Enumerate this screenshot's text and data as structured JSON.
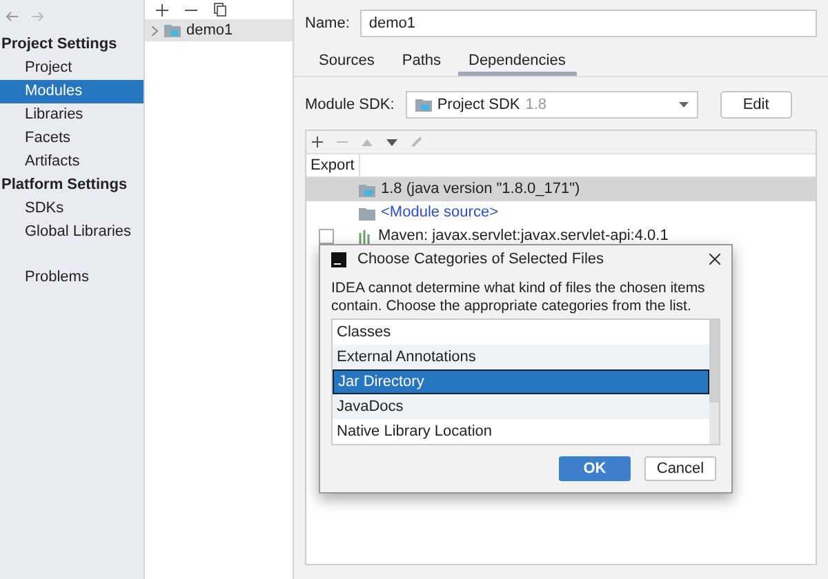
{
  "sidebar": {
    "items": [
      {
        "kind": "header",
        "label": "Project Settings",
        "selected": false
      },
      {
        "kind": "item",
        "label": "Project",
        "selected": false
      },
      {
        "kind": "item",
        "label": "Modules",
        "selected": true
      },
      {
        "kind": "item",
        "label": "Libraries",
        "selected": false
      },
      {
        "kind": "item",
        "label": "Facets",
        "selected": false
      },
      {
        "kind": "item",
        "label": "Artifacts",
        "selected": false
      },
      {
        "kind": "header",
        "label": "Platform Settings",
        "selected": false
      },
      {
        "kind": "item",
        "label": "SDKs",
        "selected": false
      },
      {
        "kind": "item",
        "label": "Global Libraries",
        "selected": false
      },
      {
        "kind": "gap",
        "label": "Problems",
        "selected": false
      }
    ]
  },
  "modules_tree": {
    "items": [
      {
        "label": "demo1",
        "expanded": false,
        "selected": true
      }
    ]
  },
  "name_field": {
    "label": "Name:",
    "value": "demo1"
  },
  "tabs": [
    {
      "label": "Sources",
      "selected": false
    },
    {
      "label": "Paths",
      "selected": false
    },
    {
      "label": "Dependencies",
      "selected": true
    }
  ],
  "module_sdk": {
    "label": "Module SDK:",
    "value": "Project SDK",
    "version": "1.8",
    "button": "Edit"
  },
  "dependencies": {
    "columns": [
      "Export"
    ],
    "rows": [
      {
        "kind": "sdk",
        "label": "1.8 (java version \"1.8.0_171\")",
        "selected": true
      },
      {
        "kind": "source",
        "label": "<Module source>",
        "selected": false
      },
      {
        "kind": "library",
        "label": "Maven: javax.servlet:javax.servlet-api:4.0.1",
        "selected": false,
        "checked": false
      }
    ]
  },
  "dialog": {
    "title": "Choose Categories of Selected Files",
    "message": "IDEA cannot determine what kind of files the chosen items contain. Choose the appropriate categories from the list.",
    "items": [
      {
        "label": "Classes",
        "selected": false
      },
      {
        "label": "External Annotations",
        "selected": false
      },
      {
        "label": "Jar Directory",
        "selected": true
      },
      {
        "label": "JavaDocs",
        "selected": false
      },
      {
        "label": "Native Library Location",
        "selected": false
      }
    ],
    "buttons": [
      {
        "label": "OK",
        "kind": "primary"
      },
      {
        "label": "Cancel",
        "kind": "secondary"
      }
    ]
  }
}
